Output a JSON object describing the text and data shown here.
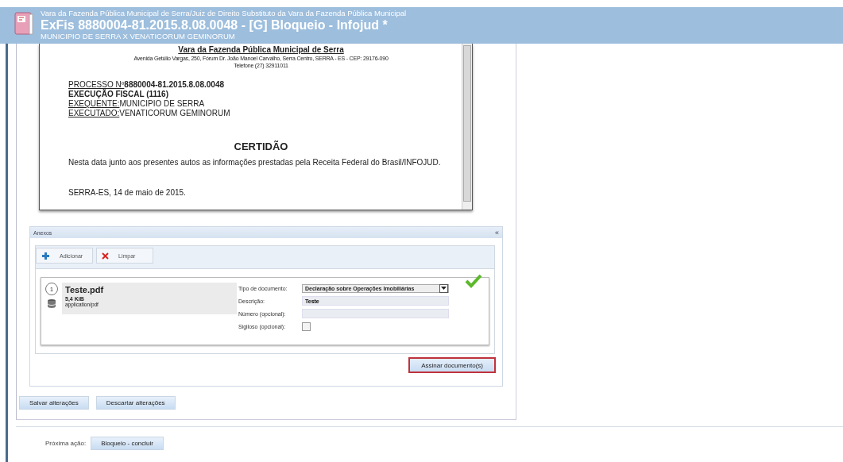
{
  "header": {
    "court": "Vara da Fazenda Pública Municipal de Serra/Juiz de Direito Substituto da Vara da Fazenda Pública Municipal",
    "title": "ExFis 8880004-81.2015.8.08.0048 - [G] Bloqueio - Infojud *",
    "parties": "MUNICIPIO DE SERRA X VENATICORUM GEMINORUM"
  },
  "document": {
    "court_name": "Vara da Fazenda Pública Municipal de Serra",
    "address": "Avenida Getúlio Vargas, 250, Fórum Dr. João Manoel Carvalho, Serra Centro, SERRA - ES - CEP: 29176-090",
    "phone": "Telefone (27) 32911011",
    "lines": [
      {
        "label": "PROCESSO Nº",
        "value": "8880004-81.2015.8.08.0048",
        "bold": true
      },
      {
        "value": "EXECUÇÃO FISCAL (1116)",
        "bold": true
      },
      {
        "label": "EXEQUENTE:",
        "value": "MUNICIPIO DE SERRA",
        "bold": false
      },
      {
        "label": "EXECUTADO:",
        "value": "VENATICORUM GEMINORUM",
        "bold": false
      }
    ],
    "heading": "CERTIDÃO",
    "body": "Nesta data junto aos presentes autos as informações prestadas pela Receita Federal do Brasil/INFOJUD.",
    "date": "SERRA-ES, 14 de maio de 2015."
  },
  "attachments": {
    "title": "Anexos",
    "collapse": "«",
    "toolbar": [
      {
        "kind": "add",
        "label": "Adicionar"
      },
      {
        "kind": "clear",
        "label": "Limpar"
      }
    ],
    "file": {
      "number": "1",
      "name": "Teste.pdf",
      "size": "5,4 KiB",
      "mime": "application/pdf"
    },
    "fields": [
      {
        "kind": "select",
        "label": "Tipo de documento:",
        "value": "Declaração sobre Operações Imobiliárias"
      },
      {
        "kind": "text",
        "label": "Descrição:",
        "value": "Teste"
      },
      {
        "kind": "text",
        "label": "Número (opcional):"
      },
      {
        "kind": "checkbox",
        "label": "Sigiloso (opcional):",
        "checked": false
      }
    ],
    "sign_button": "Assinar documento(s)"
  },
  "actions": [
    "Salvar alterações",
    "Descartar alterações"
  ],
  "next_action": {
    "label": "Próxima ação:",
    "button": "Bloqueio - concluir"
  }
}
